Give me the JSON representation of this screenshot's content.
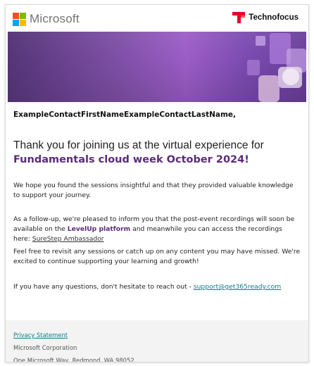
{
  "header": {
    "brand_left": "Microsoft",
    "brand_right": "Technofocus"
  },
  "banner": {
    "accent_colors": [
      "#5a3a7c",
      "#9b5cc6",
      "#c5a3e6",
      "#d6b8d8"
    ]
  },
  "content": {
    "greeting": "ExampleContactFirstNameExampleContactLastName,",
    "headline_line1": "Thank you for joining us at the virtual experience for",
    "headline_event": "Fundamentals cloud week October 2024!",
    "p1": "We hope you found the sessions insightful and that they provided valuable knowledge to support your journey.",
    "p2_before": "As a follow-up, we're pleased to inform you that the post-event recordings will soon be available on the ",
    "p2_highlight": "LevelUp platform",
    "p2_after": " and meanwhile you can access the recordings here: ",
    "p2_link": "SureStep Ambassador",
    "p3": "Feel free to revisit any sessions or catch up on any content you may have missed. We're excited to continue supporting your learning and growth!",
    "p4_before": "If you have any questions, don't hesitate to reach out - ",
    "p4_email": "support@get365ready.com"
  },
  "footer": {
    "privacy_link": "Privacy Statement",
    "company": "Microsoft Corporation",
    "address": "One Microsoft Way, Redmond, WA 98052."
  },
  "colors": {
    "event_purple": "#5b2a7a",
    "link_teal": "#0f7b8a",
    "technofocus_red": "#e4002b"
  }
}
